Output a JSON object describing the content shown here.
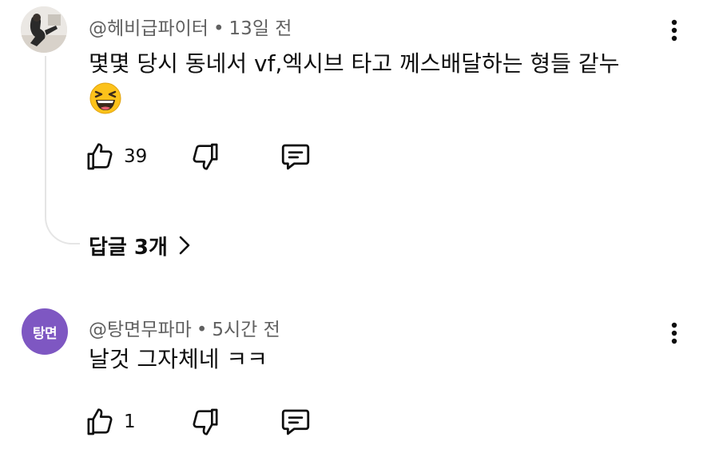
{
  "comments": [
    {
      "author": "@헤비급파이터",
      "separator": "•",
      "time": "13일 전",
      "text": "몇몇 당시 동네서 vf,엑시브 타고 께스배달하는 형들 같누",
      "emoji": "grinning-squinting-face",
      "likes": "39",
      "avatar": "photo",
      "replies_label": "답글 3개"
    },
    {
      "author": "@탕면무파마",
      "separator": "•",
      "time": "5시간 전",
      "text": "날것 그자체네 ㅋㅋ",
      "likes": "1",
      "avatar_initials": "탕면",
      "avatar_color": "#7e57c2"
    }
  ],
  "icons": {
    "like": "thumbs-up-icon",
    "dislike": "thumbs-down-icon",
    "reply": "reply-comment-icon",
    "menu": "more-vertical-icon",
    "expand": "chevron-right-icon"
  }
}
